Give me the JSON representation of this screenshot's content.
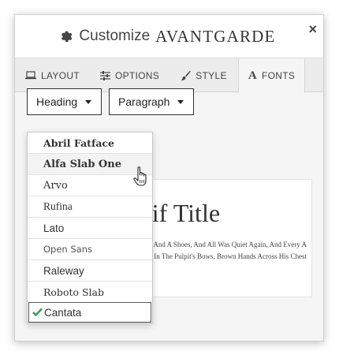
{
  "header": {
    "title_prefix": "Customize",
    "title_name": "AVANTGARDE",
    "close_glyph": "×"
  },
  "tabs": [
    {
      "label": "LAYOUT",
      "icon": "laptop-icon",
      "active": false
    },
    {
      "label": "OPTIONS",
      "icon": "sliders-icon",
      "active": false
    },
    {
      "label": "STYLE",
      "icon": "brush-icon",
      "active": false
    },
    {
      "label": "FONTS",
      "icon": "font-icon",
      "active": true
    }
  ],
  "dropdowns": {
    "heading": "Heading",
    "paragraph": "Paragraph"
  },
  "font_menu": {
    "items": [
      {
        "label": "Abril Fatface"
      },
      {
        "label": "Alfa Slab One",
        "hover": true
      },
      {
        "label": "Arvo"
      },
      {
        "label": "Rufina"
      },
      {
        "label": "Lato"
      },
      {
        "label": "Open Sans"
      },
      {
        "label": "Raleway"
      },
      {
        "label": "Roboto Slab"
      },
      {
        "label": "Cantata",
        "selected": true
      }
    ]
  },
  "preview": {
    "title": "Sans-Serif Title",
    "body": "Heavy Sea-Boots Among The Benches, And A Shoes, And All Was Quiet Again, And Every A Little; Then Kneeling In The Pulpit's Bows, Brown Hands Across His Chest"
  },
  "colors": {
    "check": "#2e9e4f",
    "border_dark": "#333333",
    "panel_bg": "#f5f5f5"
  }
}
